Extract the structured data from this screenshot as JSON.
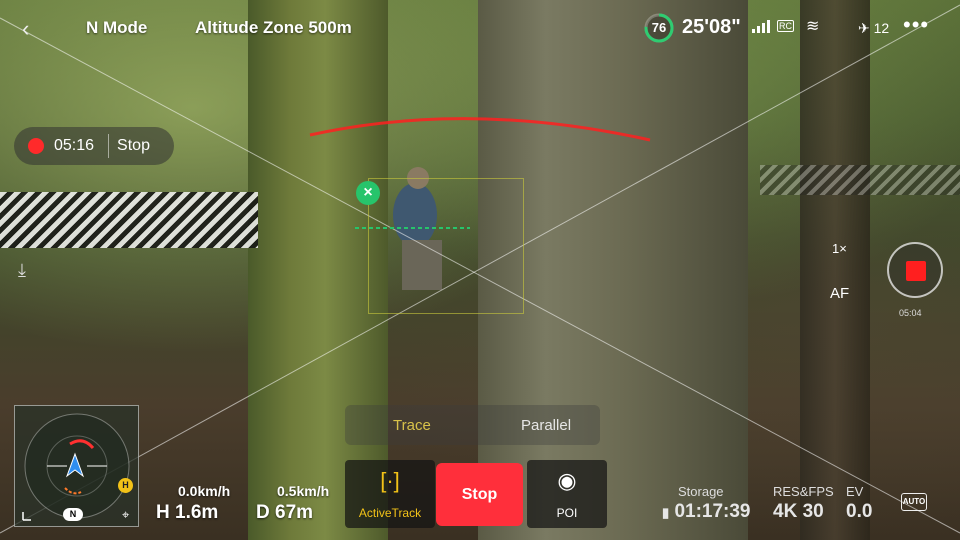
{
  "header": {
    "back_icon": "chevron-left-icon",
    "flight_mode": "N Mode",
    "altitude_zone": "Altitude Zone 500m",
    "battery_percent": "76",
    "battery_level": 0.76,
    "flight_time_remaining": "25'08\"",
    "rc_signal_label": "RC",
    "satellite_count": "12",
    "more_icon": "more-horizontal-icon"
  },
  "recording": {
    "elapsed": "05:16",
    "stop_label": "Stop"
  },
  "tracking": {
    "modes": [
      "Trace",
      "Parallel"
    ],
    "active_mode": "Trace"
  },
  "camera": {
    "zoom": "1×",
    "focus_mode": "AF",
    "shutter_timer": "05:04"
  },
  "telemetry": {
    "horizontal_speed": "0.0km/h",
    "vertical_speed": "0.5km/h",
    "height": "H 1.6m",
    "distance": "D 67m"
  },
  "radar": {
    "north_label": "N",
    "home_label": "H"
  },
  "bottom_controls": {
    "activetrack_label": "ActiveTrack",
    "stop_label": "Stop",
    "poi_label": "POI"
  },
  "camera_stats": {
    "storage_label": "Storage",
    "storage_value": "01:17:39",
    "resfps_label": "RES&FPS",
    "resfps_value": "4K 30",
    "ev_label": "EV",
    "ev_value": "0.0",
    "auto_label": "AUTO"
  },
  "colors": {
    "record_red": "#ff2f3b",
    "tracking_green": "#27c46b",
    "trace_yellow": "#d8c24a",
    "battery_green": "#2ecc71"
  }
}
